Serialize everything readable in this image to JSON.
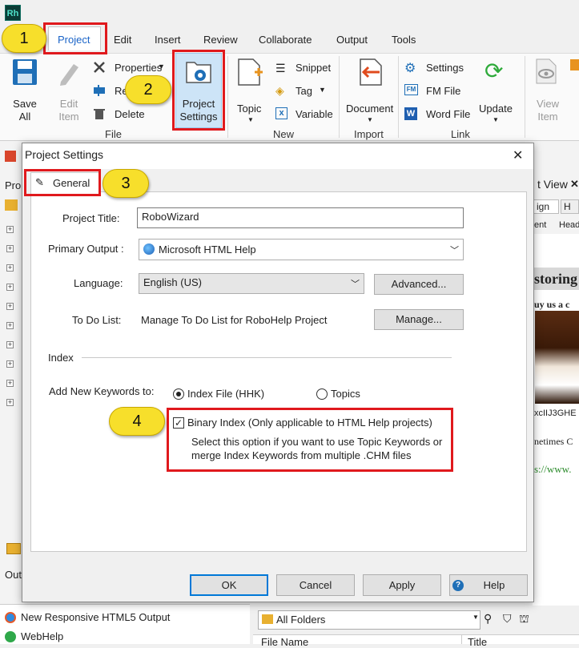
{
  "app": {
    "logo_text": "Rh"
  },
  "menu": [
    "Project",
    "Edit",
    "Insert",
    "Review",
    "Collaborate",
    "Output",
    "Tools"
  ],
  "ribbon": {
    "save_all": "Save\nAll",
    "edit_item": "Edit\nItem",
    "properties": "Properties",
    "rename_partial": "Re",
    "delete": "Delete",
    "project_settings": "Project\nSettings",
    "group_file": "File",
    "topic": "Topic",
    "snippet": "Snippet",
    "tag": "Tag",
    "variable": "Variable",
    "group_new": "New",
    "document": "Document",
    "group_import": "Import",
    "settings": "Settings",
    "fm_file": "FM File",
    "word_file": "Word File",
    "update": "Update",
    "group_link": "Link",
    "view_item": "View\nItem"
  },
  "background": {
    "left_tab": "Pro",
    "outputs_tab": "Out",
    "right_view_title": "t View",
    "right_tab1": "ign",
    "right_tab2": "H",
    "right_header_a": "ent",
    "right_header_b": "Head",
    "right_heading": "storing",
    "right_subheading": "uy us a c",
    "right_code": "xcIIJ3GHE",
    "right_text2": "netimes C",
    "right_link": "s://www.",
    "output_items": [
      "New Responsive HTML5 Output",
      "WebHelp"
    ],
    "folder_combo": "All Folders",
    "col_file_name": "File Name",
    "col_title": "Title"
  },
  "dialog": {
    "title": "Project Settings",
    "close_glyph": "✕",
    "tab_general": "General",
    "project_title_label": "Project Title:",
    "project_title_value": "RoboWizard",
    "primary_output_label": "Primary Output :",
    "primary_output_value": "Microsoft HTML Help",
    "language_label": "Language:",
    "language_value": "English (US)",
    "advanced_button": "Advanced...",
    "todo_label": "To Do List:",
    "todo_value": "Manage To Do List for RoboHelp Project",
    "manage_button": "Manage...",
    "index_section": "Index",
    "add_keywords_label": "Add New Keywords to:",
    "radio_index_file": "Index File (HHK)",
    "radio_topics": "Topics",
    "binary_index_label": "Binary Index (Only applicable to HTML Help projects)",
    "binary_index_help_1": "Select this option if you want to use Topic Keywords or",
    "binary_index_help_2": "merge Index Keywords  from multiple .CHM files",
    "ok_button": "OK",
    "cancel_button": "Cancel",
    "apply_button": "Apply",
    "help_button": "Help"
  },
  "callouts": [
    "1",
    "2",
    "3",
    "4"
  ],
  "colors": {
    "annotation_red": "#e0191d",
    "callout_yellow": "#f7df2b",
    "accent_blue": "#1a64c8"
  }
}
